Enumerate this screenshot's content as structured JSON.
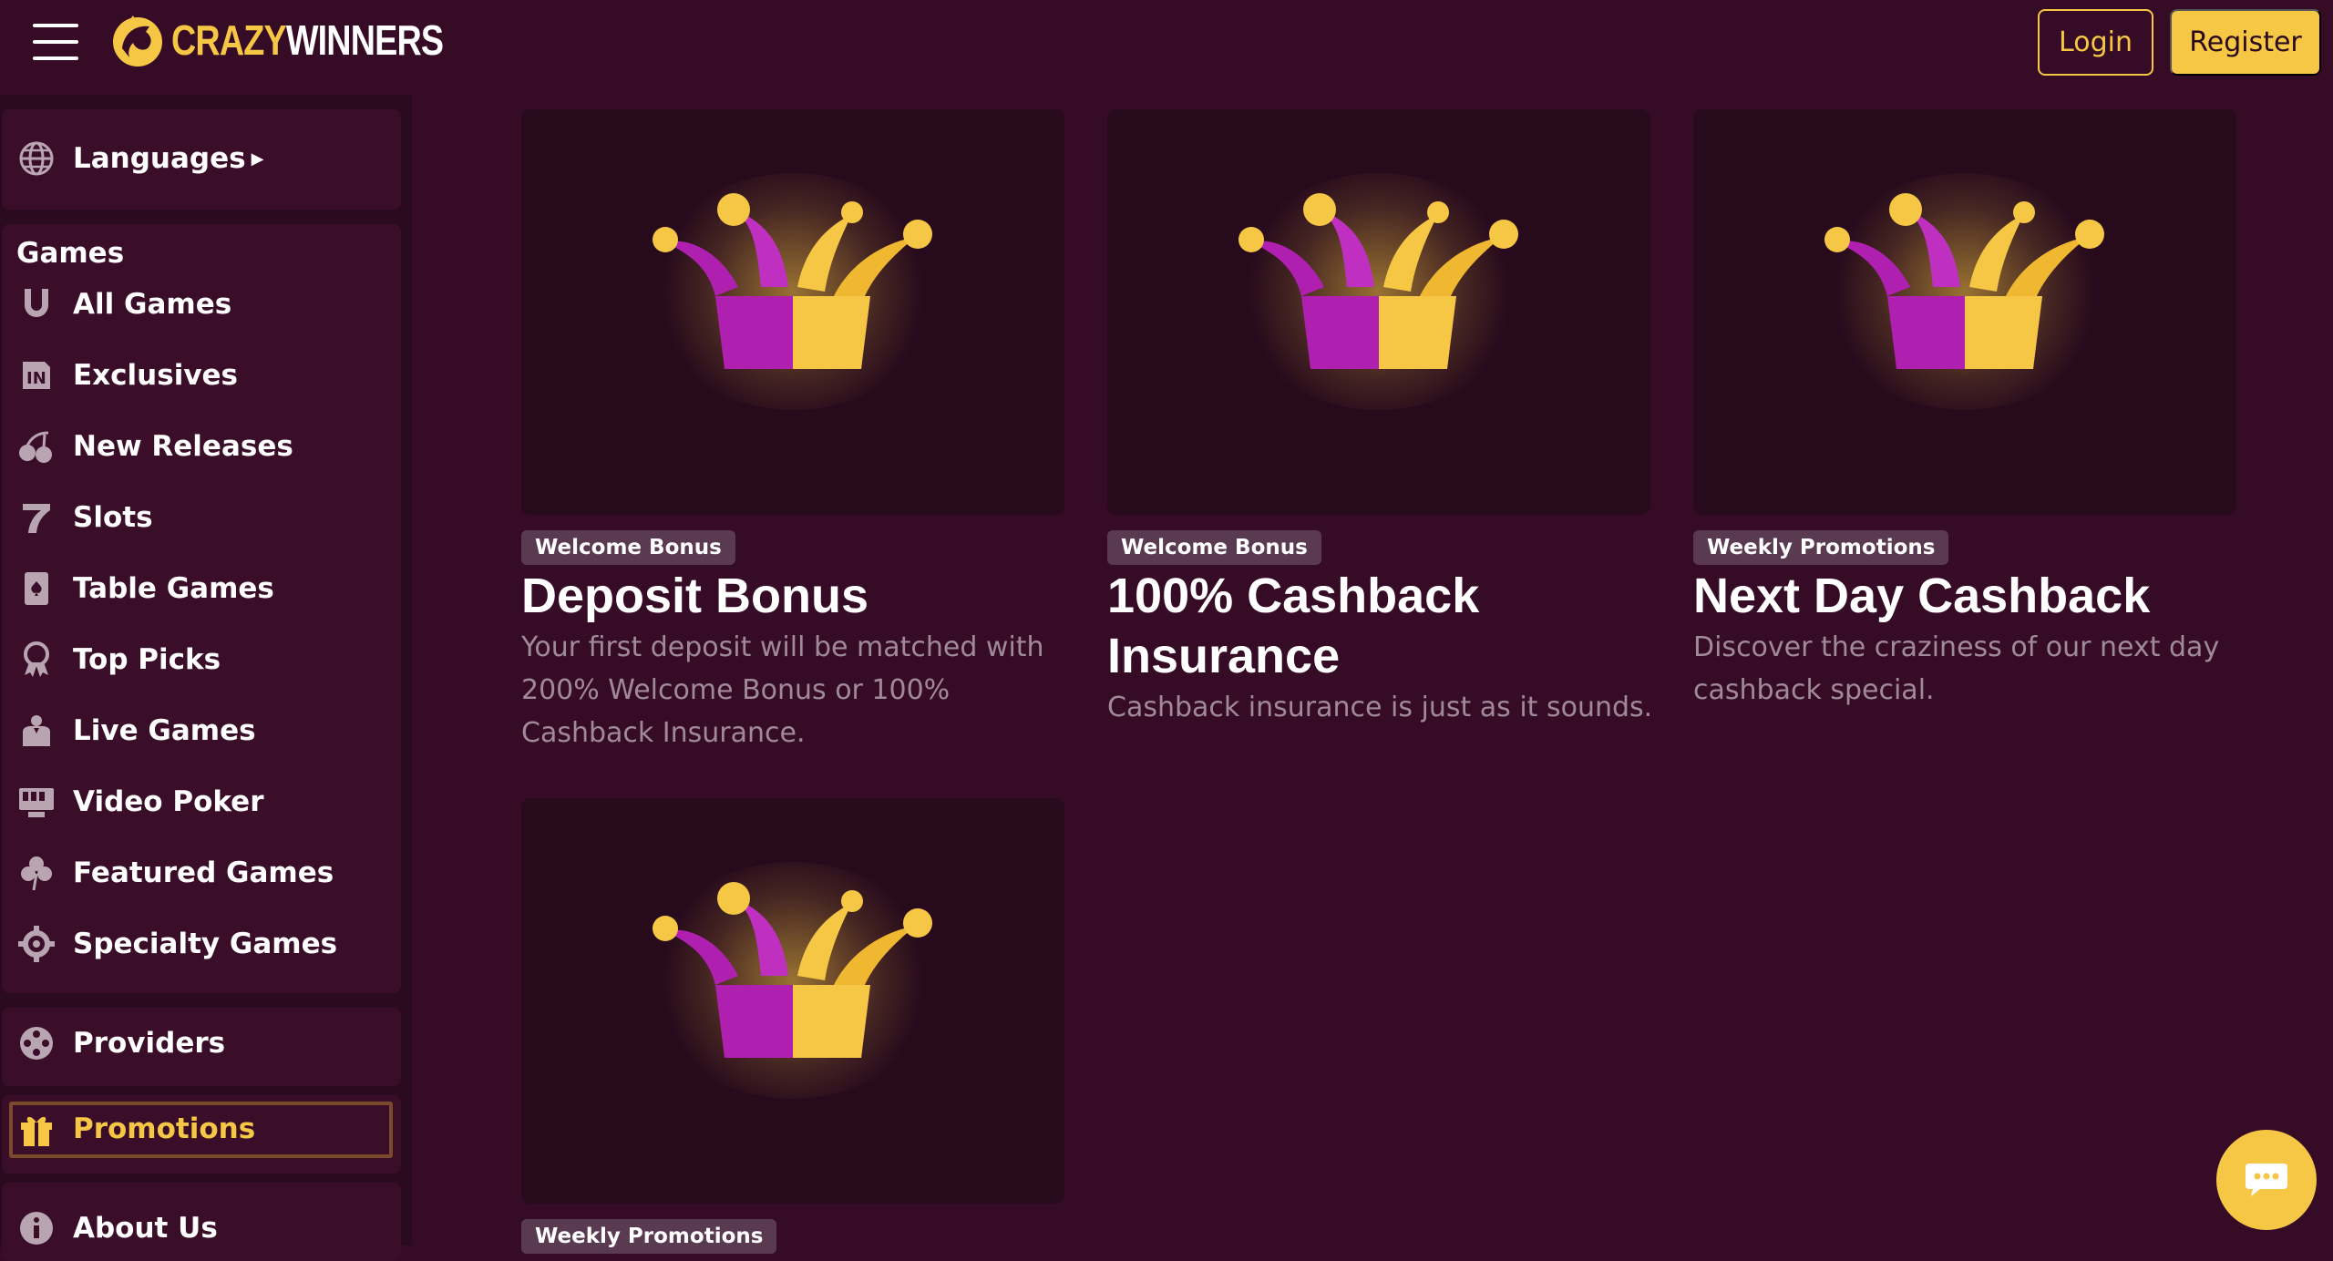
{
  "header": {
    "logo_text_a": "CRAZY",
    "logo_text_b": "WINNERS",
    "login_label": "Login",
    "register_label": "Register"
  },
  "sidebar": {
    "languages_label": "Languages",
    "games_heading": "Games",
    "game_items": [
      {
        "label": "All Games",
        "icon": "horseshoe-icon"
      },
      {
        "label": "Exclusives",
        "icon": "exclusive-badge-icon"
      },
      {
        "label": "New Releases",
        "icon": "cherries-icon"
      },
      {
        "label": "Slots",
        "icon": "lucky-seven-icon"
      },
      {
        "label": "Table Games",
        "icon": "playing-card-icon"
      },
      {
        "label": "Top Picks",
        "icon": "award-ribbon-icon"
      },
      {
        "label": "Live Games",
        "icon": "dealer-icon"
      },
      {
        "label": "Video Poker",
        "icon": "video-poker-machine-icon"
      },
      {
        "label": "Featured Games",
        "icon": "clover-icon"
      },
      {
        "label": "Specialty Games",
        "icon": "gear-wheel-icon"
      }
    ],
    "providers_label": "Providers",
    "promotions_label": "Promotions",
    "about_label": "About Us"
  },
  "promotions": [
    {
      "badge": "Welcome Bonus",
      "title": "Deposit Bonus",
      "description": "Your first deposit will be matched with 200% Welcome Bonus or 100% Cashback Insurance."
    },
    {
      "badge": "Welcome Bonus",
      "title": "100% Cashback Insurance",
      "description": "Cashback insurance is just as it sounds."
    },
    {
      "badge": "Weekly Promotions",
      "title": "Next Day Cashback",
      "description": "Discover the craziness of our next day cashback special."
    },
    {
      "badge": "Weekly Promotions"
    }
  ],
  "colors": {
    "background": "#360b26",
    "sidebar": "#2a0a1e",
    "accent": "#f6c744",
    "card": "#270a1c"
  }
}
